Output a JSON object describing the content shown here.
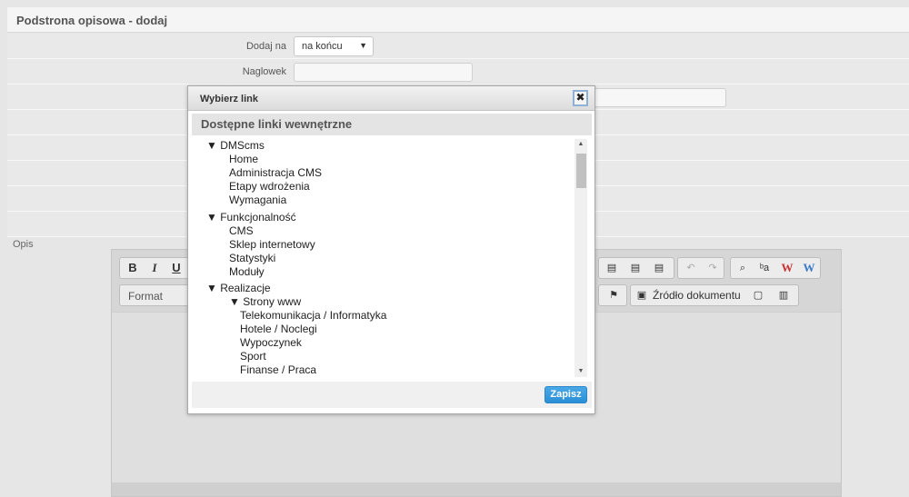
{
  "page": {
    "title": "Podstrona opisowa - dodaj"
  },
  "form": {
    "position_label": "Dodaj na",
    "position_value": "na końcu",
    "heading_label": "Naglowek",
    "description_label": "Opis"
  },
  "editor": {
    "bold": "B",
    "italic": "I",
    "underline": "U",
    "format_label": "Format",
    "source_label": "Źródło dokumentu",
    "word_red": "W",
    "word_blue": "W"
  },
  "dialog": {
    "title": "Wybierz link",
    "close": "✖",
    "section_title": "Dostępne linki wewnętrzne",
    "save_label": "Zapisz",
    "tree": [
      {
        "label": "▼  DMScms",
        "level": 0
      },
      {
        "label": "Home",
        "level": 1
      },
      {
        "label": "Administracja CMS",
        "level": 1
      },
      {
        "label": "Etapy wdrożenia",
        "level": 1
      },
      {
        "label": "Wymagania",
        "level": 1
      },
      {
        "label": "▼  Funkcjonalność",
        "level": 0
      },
      {
        "label": "CMS",
        "level": 1
      },
      {
        "label": "Sklep internetowy",
        "level": 1
      },
      {
        "label": "Statystyki",
        "level": 1
      },
      {
        "label": "Moduły",
        "level": 1
      },
      {
        "label": "▼  Realizacje",
        "level": 0
      },
      {
        "label": "▼  Strony www",
        "level": 1
      },
      {
        "label": "Telekomunikacja / Informatyka",
        "level": 2
      },
      {
        "label": "Hotele / Noclegi",
        "level": 2
      },
      {
        "label": "Wypoczynek",
        "level": 2
      },
      {
        "label": "Sport",
        "level": 2
      },
      {
        "label": "Finanse / Praca",
        "level": 2
      }
    ]
  }
}
